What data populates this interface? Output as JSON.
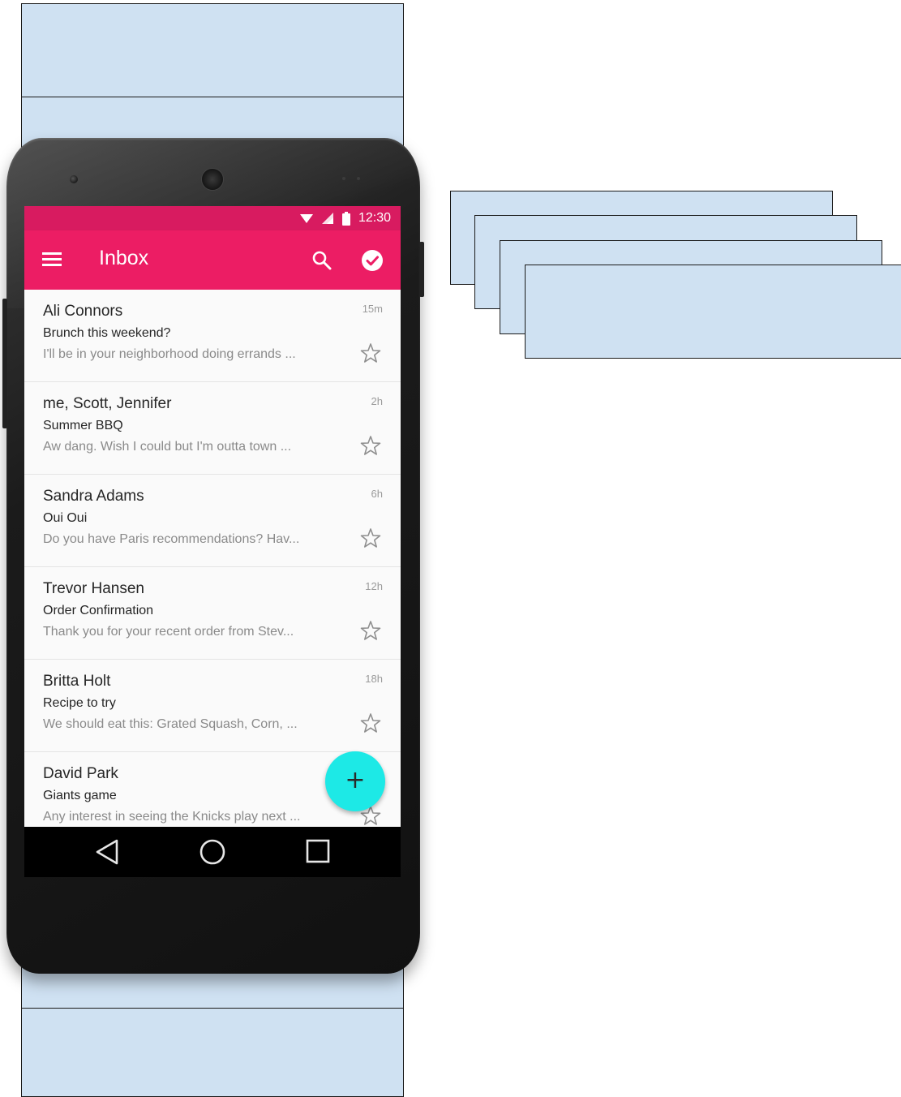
{
  "status_bar": {
    "time": "12:30",
    "icons": [
      "wifi-icon",
      "signal-icon",
      "battery-icon"
    ]
  },
  "app_bar": {
    "title": "Inbox",
    "menu_icon": "menu-icon",
    "search_icon": "search-icon",
    "action_icon": "check-circle-icon",
    "color": "#ec1d64"
  },
  "mails": [
    {
      "sender": "Ali Connors",
      "subject": "Brunch this weekend?",
      "preview": "I'll be in your neighborhood doing errands ...",
      "time": "15m"
    },
    {
      "sender": "me, Scott, Jennifer",
      "subject": "Summer BBQ",
      "preview": "Aw dang. Wish I could but I'm outta town ...",
      "time": "2h"
    },
    {
      "sender": "Sandra Adams",
      "subject": "Oui Oui",
      "preview": "Do you have Paris recommendations? Hav...",
      "time": "6h"
    },
    {
      "sender": "Trevor Hansen",
      "subject": "Order Confirmation",
      "preview": "Thank you for your recent order from Stev...",
      "time": "12h"
    },
    {
      "sender": "Britta Holt",
      "subject": "Recipe to try",
      "preview": "We should eat this: Grated Squash, Corn, ...",
      "time": "18h"
    },
    {
      "sender": "David Park",
      "subject": "Giants game",
      "preview": "Any interest in seeing the Knicks play next ...",
      "time": ""
    }
  ],
  "fab": {
    "label": "+",
    "color": "#1de9e6"
  },
  "nav_bar": {
    "buttons": [
      "back-icon",
      "home-icon",
      "recents-icon"
    ]
  }
}
